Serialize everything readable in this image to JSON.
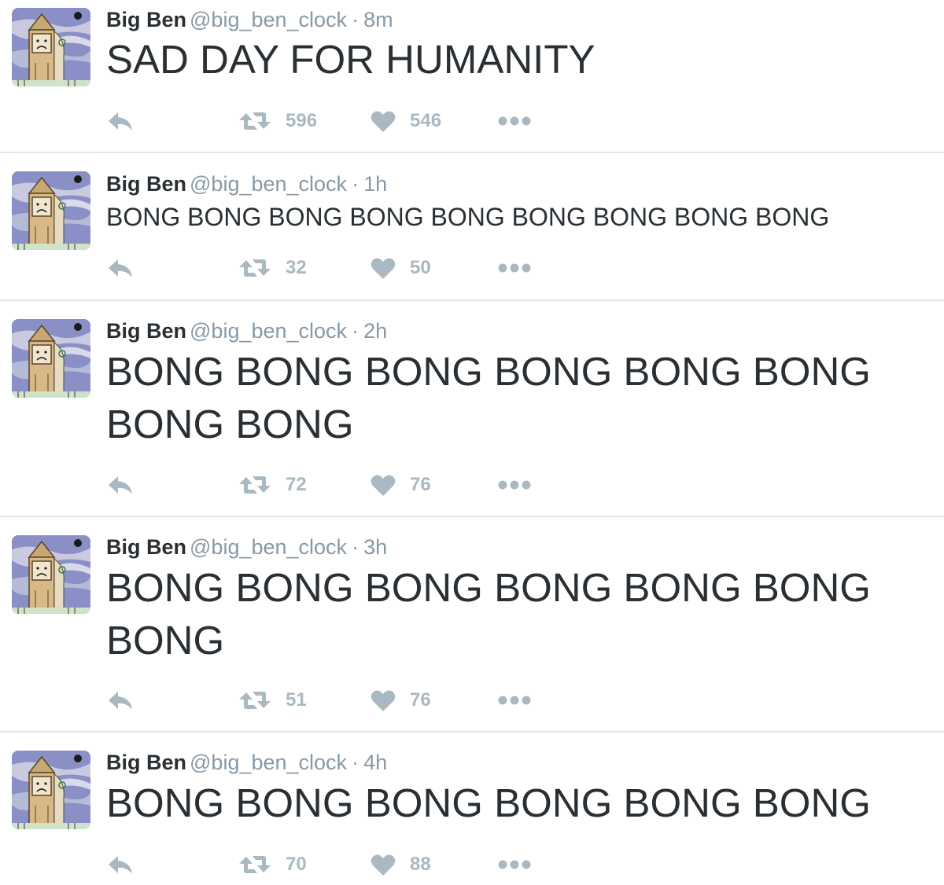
{
  "account": {
    "name": "Big Ben",
    "handle": "@big_ben_clock",
    "separator": "·"
  },
  "colors": {
    "text": "#292f33",
    "meta": "#8899a6",
    "action": "#aab8c2",
    "divider": "#e1e8ed"
  },
  "icons": {
    "reply": "reply-icon",
    "retweet": "retweet-icon",
    "like": "heart-icon",
    "more": "more-dots-icon",
    "avatar": "big-ben-sad-avatar"
  },
  "tweets": [
    {
      "time": "8m",
      "text": "SAD DAY FOR HUMANITY",
      "retweets": "596",
      "likes": "546"
    },
    {
      "time": "1h",
      "text": "BONG BONG BONG BONG BONG BONG BONG BONG BONG",
      "retweets": "32",
      "likes": "50"
    },
    {
      "time": "2h",
      "text": "BONG BONG BONG BONG BONG BONG BONG BONG",
      "retweets": "72",
      "likes": "76"
    },
    {
      "time": "3h",
      "text": "BONG BONG BONG BONG BONG BONG BONG",
      "retweets": "51",
      "likes": "76"
    },
    {
      "time": "4h",
      "text": "BONG BONG BONG BONG BONG BONG",
      "retweets": "70",
      "likes": "88"
    }
  ]
}
